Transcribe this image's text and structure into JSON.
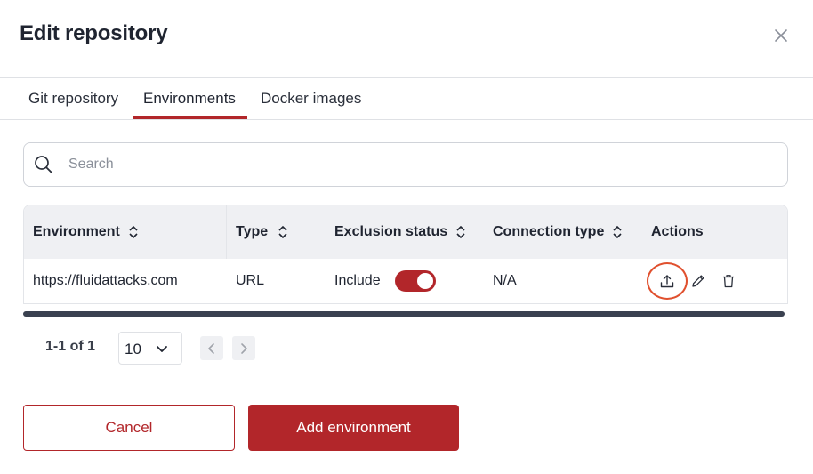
{
  "dialog": {
    "title": "Edit repository",
    "close_icon": "close-icon"
  },
  "tabs": [
    {
      "label": "Git repository",
      "active": false
    },
    {
      "label": "Environments",
      "active": true
    },
    {
      "label": "Docker images",
      "active": false
    }
  ],
  "search": {
    "placeholder": "Search",
    "value": "",
    "icon": "search-icon"
  },
  "table": {
    "columns": [
      {
        "label": "Environment",
        "sortable": true
      },
      {
        "label": "Type",
        "sortable": true
      },
      {
        "label": "Exclusion status",
        "sortable": true
      },
      {
        "label": "Connection type",
        "sortable": true
      },
      {
        "label": "Actions",
        "sortable": false
      }
    ],
    "rows": [
      {
        "environment": "https://fluidattacks.com",
        "type": "URL",
        "exclusion_status": "Include",
        "exclusion_toggle_on": true,
        "connection_type": "N/A",
        "actions": [
          "upload-icon",
          "edit-pencil-icon",
          "trash-icon"
        ]
      }
    ]
  },
  "pagination": {
    "count_text": "1-1 of 1",
    "page_size": "10"
  },
  "footer": {
    "cancel_label": "Cancel",
    "add_label": "Add environment"
  },
  "colors": {
    "accent": "#b2262a",
    "highlight": "#e0502e",
    "header_bg": "#eff0f3"
  }
}
